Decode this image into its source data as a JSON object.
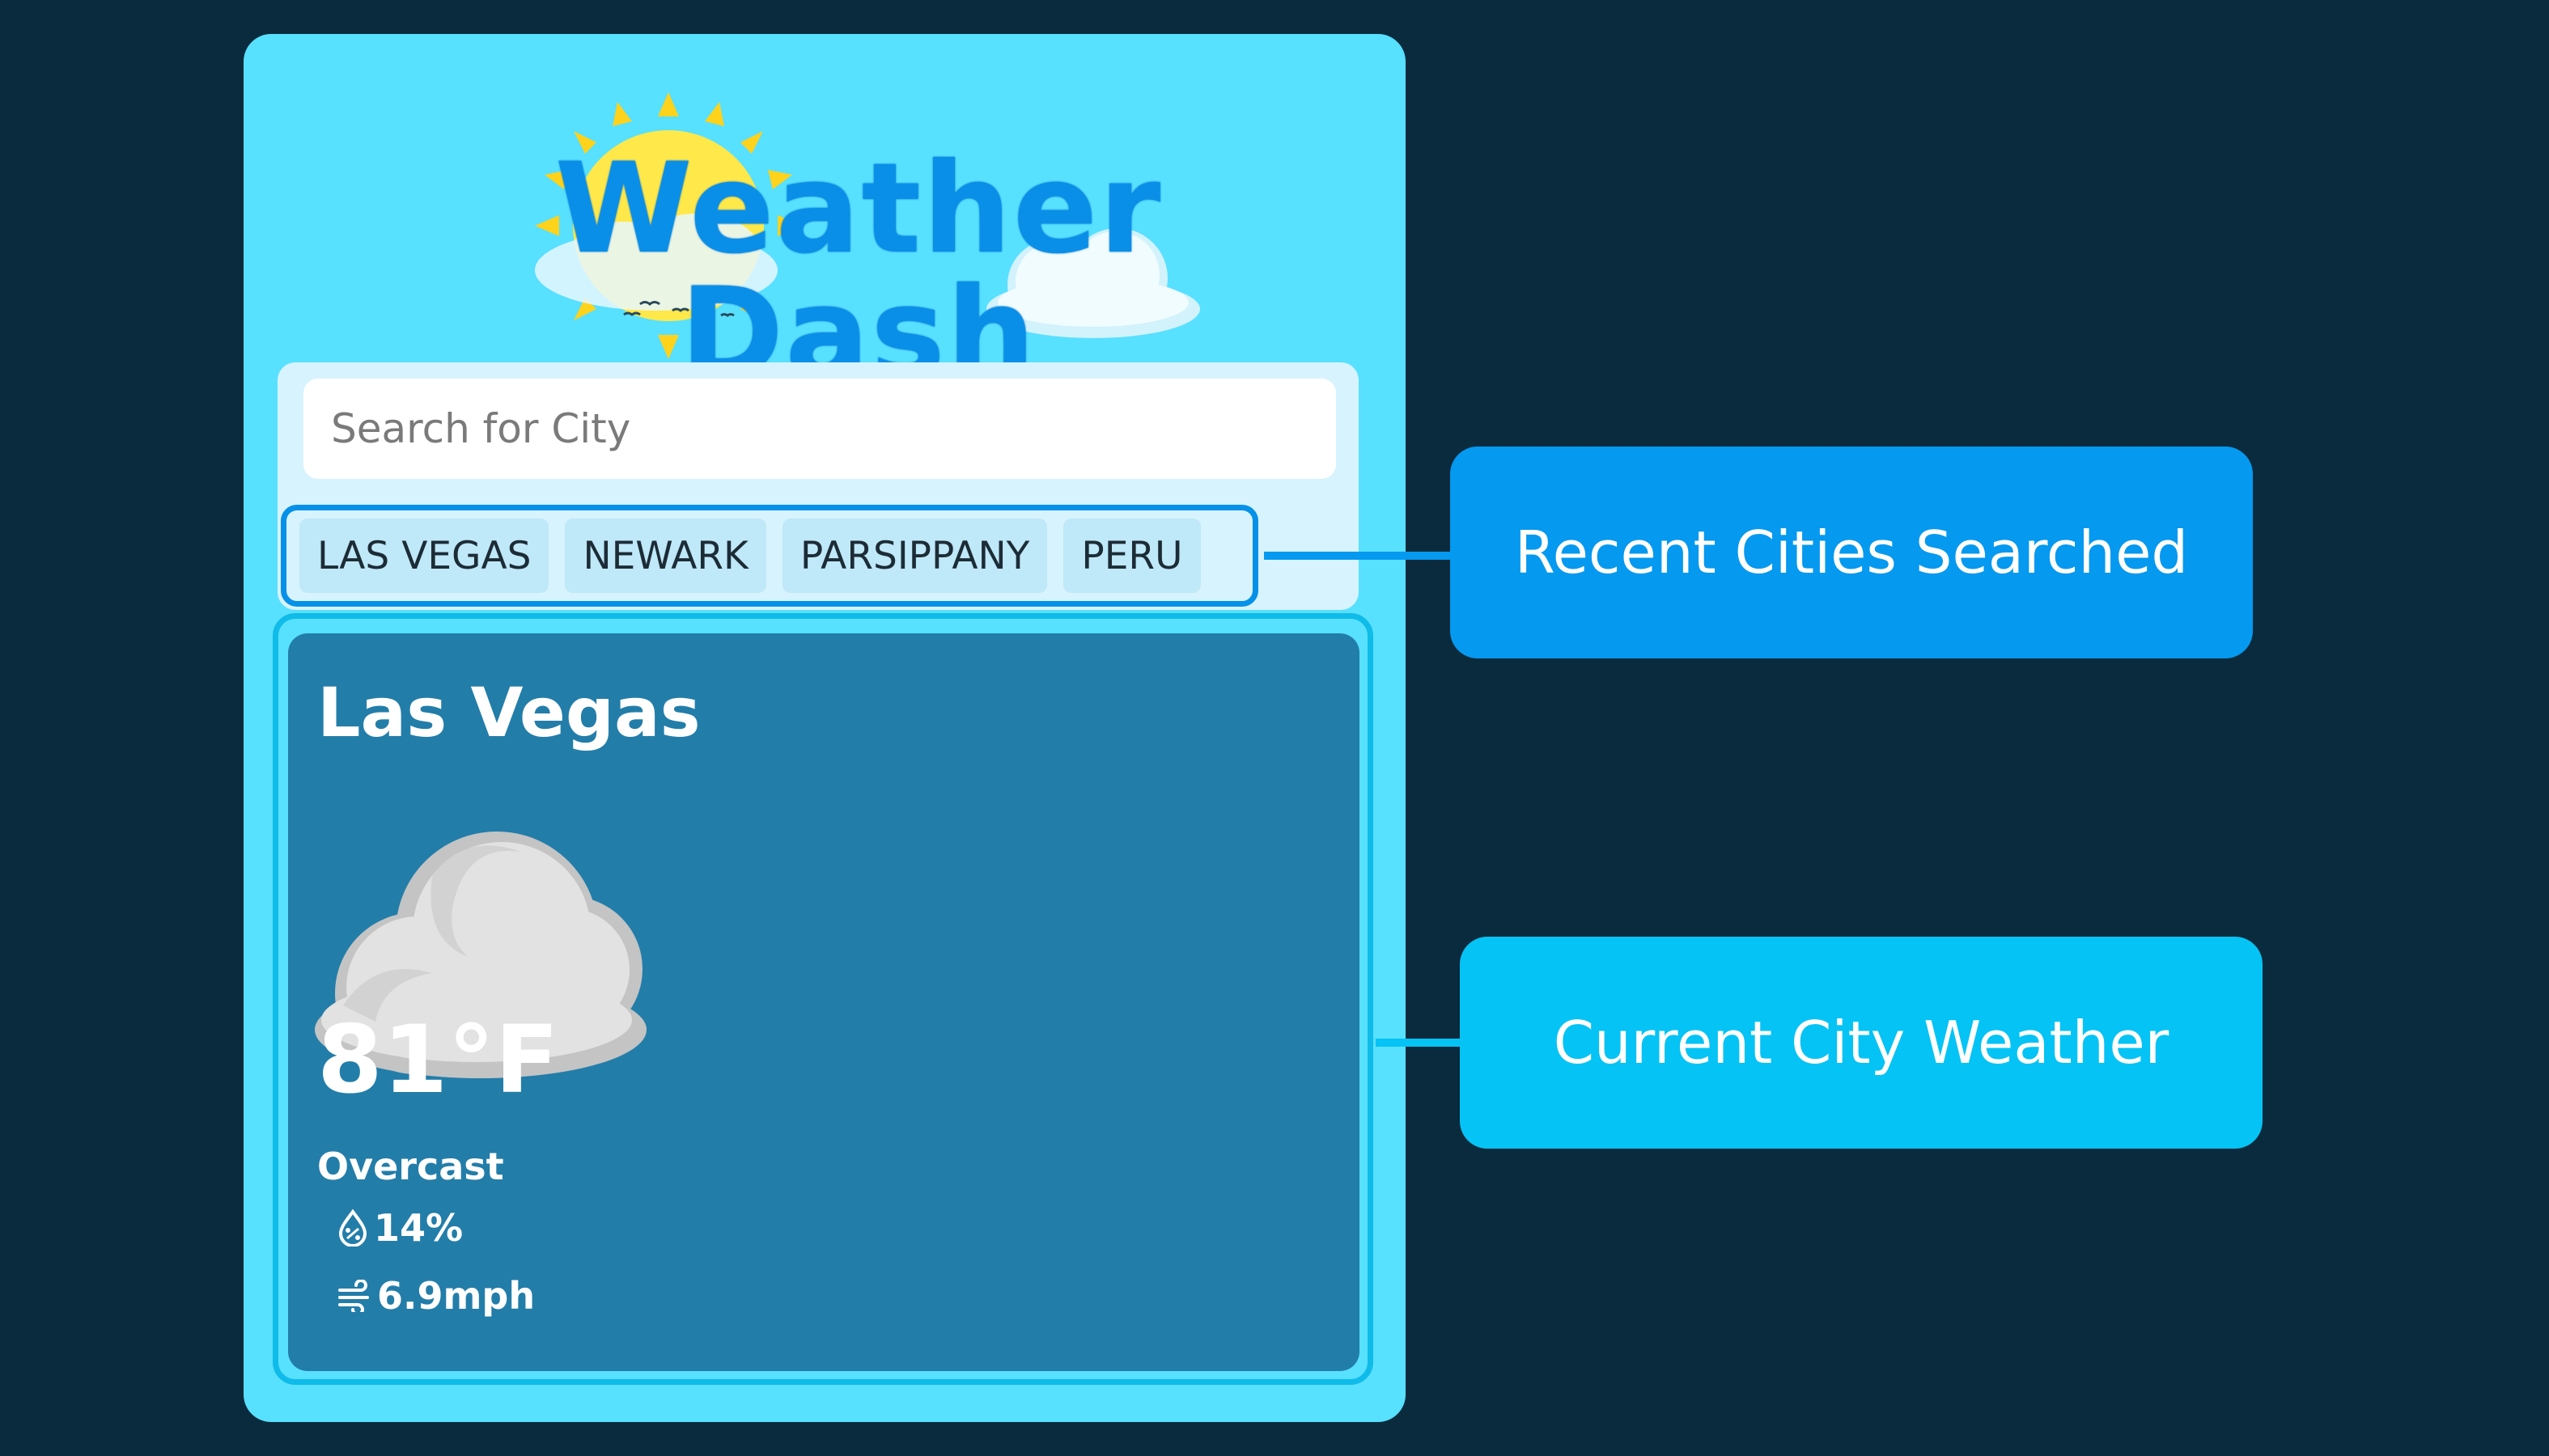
{
  "header": {
    "title": "Weather Dash",
    "decorations": [
      "sun-icon",
      "cloud-icon"
    ]
  },
  "search": {
    "placeholder": "Search for City"
  },
  "recent_cities": [
    "LAS VEGAS",
    "NEWARK",
    "PARSIPPANY",
    "PERU"
  ],
  "current": {
    "city": "Las Vegas",
    "icon": "overcast-cloud-icon",
    "temperature": "81°F",
    "condition": "Overcast",
    "humidity": "14%",
    "wind": "6.9mph"
  },
  "annotations": {
    "recent_label": "Recent Cities Searched",
    "current_label": "Current City Weather"
  },
  "colors": {
    "page_background": "#0a2b3d",
    "app_background": "#58e0ff",
    "title": "#0a8fe8",
    "current_card": "#237da9",
    "callout_recent": "#0599f0",
    "callout_current": "#05c3f5"
  }
}
